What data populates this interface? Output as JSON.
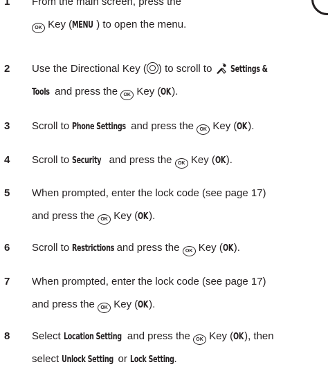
{
  "steps": [
    {
      "num": "1",
      "lines": [
        [
          {
            "t": "From the main screen, press the"
          }
        ],
        [
          {
            "icon": "ok-key-icon"
          },
          {
            "t": " Key ("
          },
          {
            "k": "MENU"
          },
          {
            "t": ") to open the menu."
          }
        ]
      ]
    },
    {
      "num": "2",
      "lines": [
        [
          {
            "t": "Use the Directional Key ("
          },
          {
            "icon": "directional-key-icon"
          },
          {
            "t": ") to scroll to "
          },
          {
            "icon": "settings-tools-icon"
          },
          {
            "t": " "
          },
          {
            "k": "Settings &"
          }
        ],
        [
          {
            "k": "Tools"
          },
          {
            "t": " and press the "
          },
          {
            "icon": "ok-key-icon"
          },
          {
            "t": " Key ("
          },
          {
            "k": "OK"
          },
          {
            "t": ")."
          }
        ]
      ]
    },
    {
      "num": "3",
      "lines": [
        [
          {
            "t": "Scroll to "
          },
          {
            "k": "Phone Settings"
          },
          {
            "t": " and press the "
          },
          {
            "icon": "ok-key-icon"
          },
          {
            "t": " Key ("
          },
          {
            "k": "OK"
          },
          {
            "t": ")."
          }
        ]
      ]
    },
    {
      "num": "4",
      "lines": [
        [
          {
            "t": "Scroll to "
          },
          {
            "k": "Security"
          },
          {
            "t": " and press the "
          },
          {
            "icon": "ok-key-icon"
          },
          {
            "t": " Key ("
          },
          {
            "k": "OK"
          },
          {
            "t": ")."
          }
        ]
      ]
    },
    {
      "num": "5",
      "lines": [
        [
          {
            "t": "When prompted, enter the lock code (see page 17)"
          }
        ],
        [
          {
            "t": "and press the "
          },
          {
            "icon": "ok-key-icon"
          },
          {
            "t": " Key ("
          },
          {
            "k": "OK"
          },
          {
            "t": ")."
          }
        ]
      ]
    },
    {
      "num": "6",
      "lines": [
        [
          {
            "t": "Scroll to "
          },
          {
            "k": "Restrictions"
          },
          {
            "t": " and press the "
          },
          {
            "icon": "ok-key-icon"
          },
          {
            "t": " Key ("
          },
          {
            "k": "OK"
          },
          {
            "t": ")."
          }
        ]
      ]
    },
    {
      "num": "7",
      "lines": [
        [
          {
            "t": "When prompted, enter the lock code (see page 17)"
          }
        ],
        [
          {
            "t": "and press the "
          },
          {
            "icon": "ok-key-icon"
          },
          {
            "t": " Key ("
          },
          {
            "k": "OK"
          },
          {
            "t": ")."
          }
        ]
      ]
    },
    {
      "num": "8",
      "lines": [
        [
          {
            "t": "Select "
          },
          {
            "k": "Location Setting"
          },
          {
            "t": " and press the "
          },
          {
            "icon": "ok-key-icon"
          },
          {
            "t": " Key ("
          },
          {
            "k": "OK"
          },
          {
            "t": "), then"
          }
        ],
        [
          {
            "t": "select "
          },
          {
            "k": "Unlock Setting"
          },
          {
            "t": " or "
          },
          {
            "k": "Lock Setting"
          },
          {
            "t": "."
          }
        ]
      ]
    }
  ],
  "ok_key_glyph": "OK",
  "icons": {
    "corner": "page-corner-mark"
  },
  "colors": {
    "text": "#231f20",
    "background": "#ffffff"
  }
}
